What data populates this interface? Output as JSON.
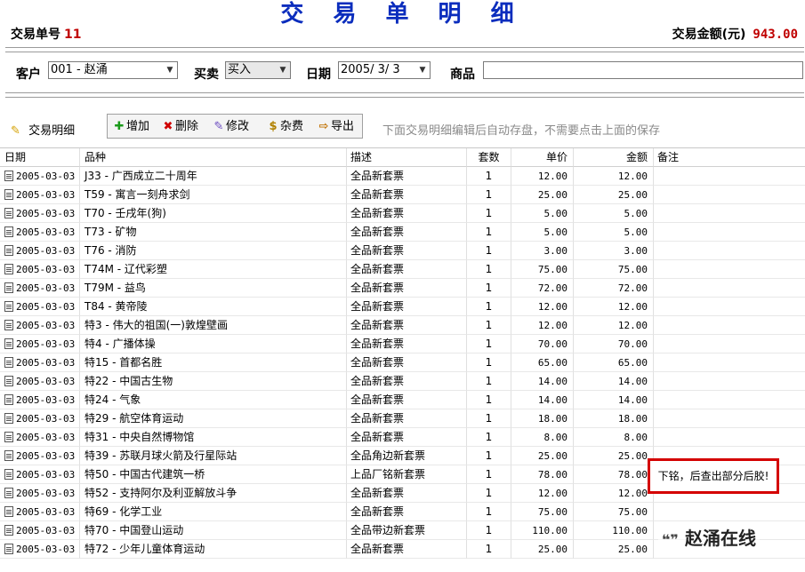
{
  "header": {
    "title": "交 易 单 明 细",
    "order_label": "交易单号",
    "order_number": "11",
    "amount_label": "交易金额(元)",
    "amount_value": "943.00"
  },
  "filters": {
    "customer_label": "客户",
    "customer_value": "001 - 赵涌",
    "trade_label": "买卖",
    "trade_value": "买入",
    "date_label": "日期",
    "date_value": "2005/ 3/ 3",
    "product_label": "商品",
    "product_value": ""
  },
  "toolbar": {
    "caption": "交易明细",
    "add": "增加",
    "delete": "删除",
    "edit": "修改",
    "misc": "杂费",
    "export": "导出",
    "hint": "下面交易明细编辑后自动存盘，不需要点击上面的保存"
  },
  "table": {
    "headers": [
      "日期",
      "品种",
      "描述",
      "套数",
      "单价",
      "金额",
      "备注"
    ],
    "rows": [
      {
        "date": "2005-03-03",
        "name": "J33 - 广西成立二十周年",
        "desc": "全品新套票",
        "qty": "1",
        "price": "12.00",
        "amount": "12.00",
        "note": ""
      },
      {
        "date": "2005-03-03",
        "name": "T59 - 寓言一刻舟求剑",
        "desc": "全品新套票",
        "qty": "1",
        "price": "25.00",
        "amount": "25.00",
        "note": ""
      },
      {
        "date": "2005-03-03",
        "name": "T70 - 壬戌年(狗)",
        "desc": "全品新套票",
        "qty": "1",
        "price": "5.00",
        "amount": "5.00",
        "note": ""
      },
      {
        "date": "2005-03-03",
        "name": "T73 - 矿物",
        "desc": "全品新套票",
        "qty": "1",
        "price": "5.00",
        "amount": "5.00",
        "note": ""
      },
      {
        "date": "2005-03-03",
        "name": "T76 - 消防",
        "desc": "全品新套票",
        "qty": "1",
        "price": "3.00",
        "amount": "3.00",
        "note": ""
      },
      {
        "date": "2005-03-03",
        "name": "T74M - 辽代彩塑",
        "desc": "全品新套票",
        "qty": "1",
        "price": "75.00",
        "amount": "75.00",
        "note": ""
      },
      {
        "date": "2005-03-03",
        "name": "T79M - 益鸟",
        "desc": "全品新套票",
        "qty": "1",
        "price": "72.00",
        "amount": "72.00",
        "note": ""
      },
      {
        "date": "2005-03-03",
        "name": "T84 - 黄帝陵",
        "desc": "全品新套票",
        "qty": "1",
        "price": "12.00",
        "amount": "12.00",
        "note": ""
      },
      {
        "date": "2005-03-03",
        "name": "特3 - 伟大的祖国(一)敦煌壁画",
        "desc": "全品新套票",
        "qty": "1",
        "price": "12.00",
        "amount": "12.00",
        "note": ""
      },
      {
        "date": "2005-03-03",
        "name": "特4 - 广播体操",
        "desc": "全品新套票",
        "qty": "1",
        "price": "70.00",
        "amount": "70.00",
        "note": ""
      },
      {
        "date": "2005-03-03",
        "name": "特15 - 首都名胜",
        "desc": "全品新套票",
        "qty": "1",
        "price": "65.00",
        "amount": "65.00",
        "note": ""
      },
      {
        "date": "2005-03-03",
        "name": "特22 - 中国古生物",
        "desc": "全品新套票",
        "qty": "1",
        "price": "14.00",
        "amount": "14.00",
        "note": ""
      },
      {
        "date": "2005-03-03",
        "name": "特24 - 气象",
        "desc": "全品新套票",
        "qty": "1",
        "price": "14.00",
        "amount": "14.00",
        "note": ""
      },
      {
        "date": "2005-03-03",
        "name": "特29 - 航空体育运动",
        "desc": "全品新套票",
        "qty": "1",
        "price": "18.00",
        "amount": "18.00",
        "note": ""
      },
      {
        "date": "2005-03-03",
        "name": "特31 - 中央自然博物馆",
        "desc": "全品新套票",
        "qty": "1",
        "price": "8.00",
        "amount": "8.00",
        "note": ""
      },
      {
        "date": "2005-03-03",
        "name": "特39 - 苏联月球火箭及行星际站",
        "desc": "全品角边新套票",
        "qty": "1",
        "price": "25.00",
        "amount": "25.00",
        "note": ""
      },
      {
        "date": "2005-03-03",
        "name": "特50 - 中国古代建筑一桥",
        "desc": "上品厂铭新套票",
        "qty": "1",
        "price": "78.00",
        "amount": "78.00",
        "note": "下铭，后查出部分后胶!"
      },
      {
        "date": "2005-03-03",
        "name": "特52 - 支持阿尔及利亚解放斗争",
        "desc": "全品新套票",
        "qty": "1",
        "price": "12.00",
        "amount": "12.00",
        "note": ""
      },
      {
        "date": "2005-03-03",
        "name": "特69 - 化学工业",
        "desc": "全品新套票",
        "qty": "1",
        "price": "75.00",
        "amount": "75.00",
        "note": ""
      },
      {
        "date": "2005-03-03",
        "name": "特70 - 中国登山运动",
        "desc": "全品带边新套票",
        "qty": "1",
        "price": "110.00",
        "amount": "110.00",
        "note": ""
      },
      {
        "date": "2005-03-03",
        "name": "特72 - 少年儿童体育运动",
        "desc": "全品新套票",
        "qty": "1",
        "price": "25.00",
        "amount": "25.00",
        "note": ""
      }
    ]
  },
  "watermark": "赵涌在线"
}
